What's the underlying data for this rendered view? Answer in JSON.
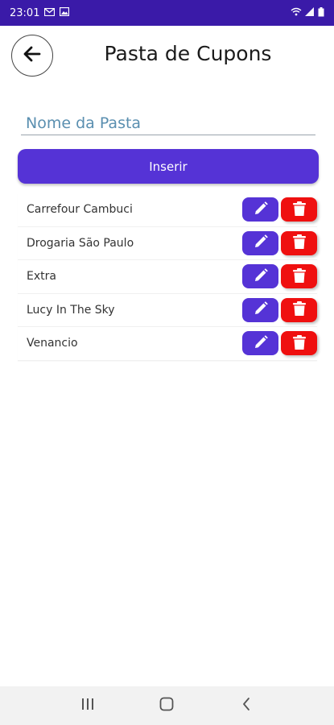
{
  "status_bar": {
    "time": "23:01",
    "left_icons": [
      "gmail-icon",
      "image-icon"
    ],
    "right_icons": [
      "wifi-icon",
      "signal-icon",
      "battery-icon"
    ],
    "background": "#3a1aa8"
  },
  "header": {
    "back_icon": "arrow-left-icon",
    "title": "Pasta de Cupons"
  },
  "form": {
    "input_value": "",
    "input_placeholder": "Nome da Pasta",
    "insert_label": "Inserir"
  },
  "folders": [
    {
      "name": "Carrefour Cambuci",
      "edit_icon": "pencil-icon",
      "delete_icon": "trash-icon"
    },
    {
      "name": "Drogaria São Paulo",
      "edit_icon": "pencil-icon",
      "delete_icon": "trash-icon"
    },
    {
      "name": "Extra",
      "edit_icon": "pencil-icon",
      "delete_icon": "trash-icon"
    },
    {
      "name": "Lucy In The Sky",
      "edit_icon": "pencil-icon",
      "delete_icon": "trash-icon"
    },
    {
      "name": "Venancio",
      "edit_icon": "pencil-icon",
      "delete_icon": "trash-icon"
    }
  ],
  "colors": {
    "accent": "#5533d6",
    "danger": "#ef1010",
    "status_bar": "#3a1aa8"
  },
  "nav_bar": {
    "icons": [
      "recent-apps-icon",
      "home-icon",
      "back-nav-icon"
    ]
  }
}
